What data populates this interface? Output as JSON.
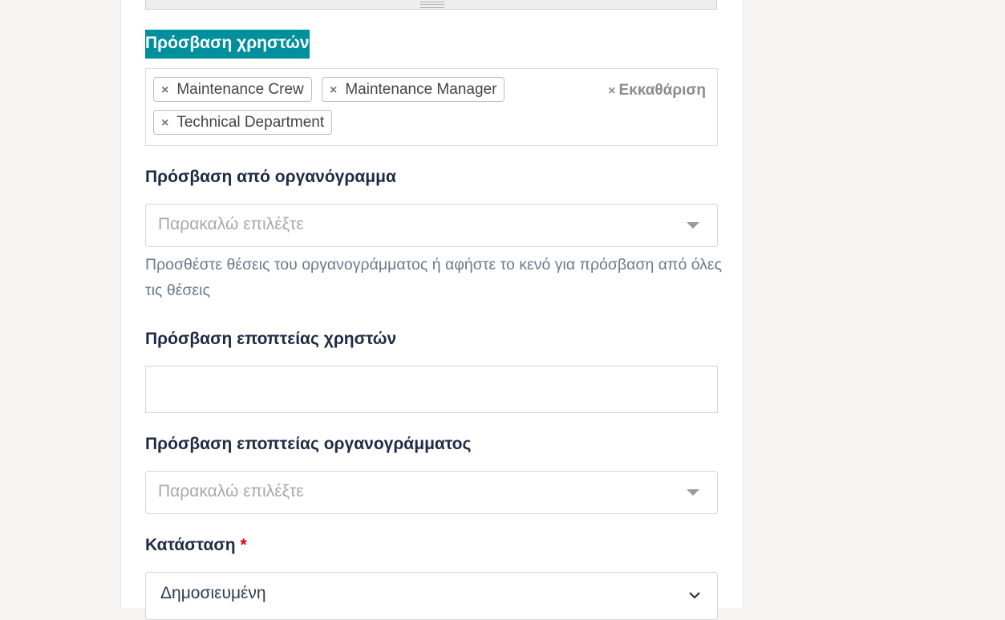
{
  "user_access": {
    "label": "Πρόσβαση χρηστών",
    "tags": [
      {
        "remove": "×",
        "text": "Maintenance Crew"
      },
      {
        "remove": "×",
        "text": "Maintenance Manager"
      },
      {
        "remove": "×",
        "text": "Technical Department"
      }
    ],
    "clear_icon": "×",
    "clear_label": "Εκκαθάριση"
  },
  "org_access": {
    "label": "Πρόσβαση από οργανόγραμμα",
    "placeholder": "Παρακαλώ επιλέξτε",
    "help": "Προσθέστε θέσεις του οργανογράμματος ή αφήστε το κενό για πρόσβαση από όλες τις θέσεις"
  },
  "user_supervision": {
    "label": "Πρόσβαση εποπτείας χρηστών"
  },
  "org_supervision": {
    "label": "Πρόσβαση εποπτείας οργανογράμματος",
    "placeholder": "Παρακαλώ επιλέξτε"
  },
  "status": {
    "label": "Κατάσταση",
    "required_mark": "*",
    "value": "Δημοσιευμένη"
  },
  "icons": {
    "tag_remove": "close-icon",
    "dropdown": "caret-down-icon",
    "status_dropdown": "chevron-down-icon",
    "resize": "resize-grip-icon"
  },
  "colors": {
    "highlight": "#008f9c",
    "label": "#1f2a44",
    "required": "#e00000",
    "help_text": "#6b7a8c"
  }
}
